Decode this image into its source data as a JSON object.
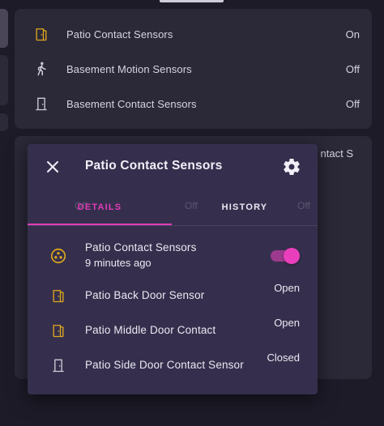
{
  "background": {
    "card_rows": [
      {
        "icon": "door-open-icon",
        "name": "Patio Contact Sensors",
        "state": "On",
        "icon_color": "#e0a81d"
      },
      {
        "icon": "walking-person-icon",
        "name": "Basement Motion Sensors",
        "state": "Off",
        "icon_color": "#d0ccd9"
      },
      {
        "icon": "door-closed-icon",
        "name": "Basement Contact Sensors",
        "state": "Off",
        "icon_color": "#d0ccd9"
      }
    ],
    "card2_peek": "ntact S",
    "ghost_left": "Off",
    "ghost_mid": "Off",
    "ghost_right": "Off"
  },
  "dialog": {
    "title": "Patio Contact Sensors",
    "tabs": [
      {
        "label": "DETAILS",
        "active": true
      },
      {
        "label": "HISTORY",
        "active": false
      }
    ],
    "group": {
      "name": "Patio Contact Sensors",
      "subtitle": "9 minutes ago",
      "toggle_on": true,
      "icon": "group-circle-icon"
    },
    "entities": [
      {
        "icon": "door-open-icon",
        "name": "Patio Back Door Sensor",
        "state": "Open"
      },
      {
        "icon": "door-open-icon",
        "name": "Patio Middle Door Contact",
        "state": "Open"
      },
      {
        "icon": "door-closed-icon",
        "name": "Patio Side Door Contact Sensor",
        "state": "Closed"
      }
    ]
  },
  "colors": {
    "accent": "#e23bb8",
    "active_icon": "#e0a81d",
    "dialog_bg": "#352f4d",
    "card_bg": "#2b2838"
  }
}
